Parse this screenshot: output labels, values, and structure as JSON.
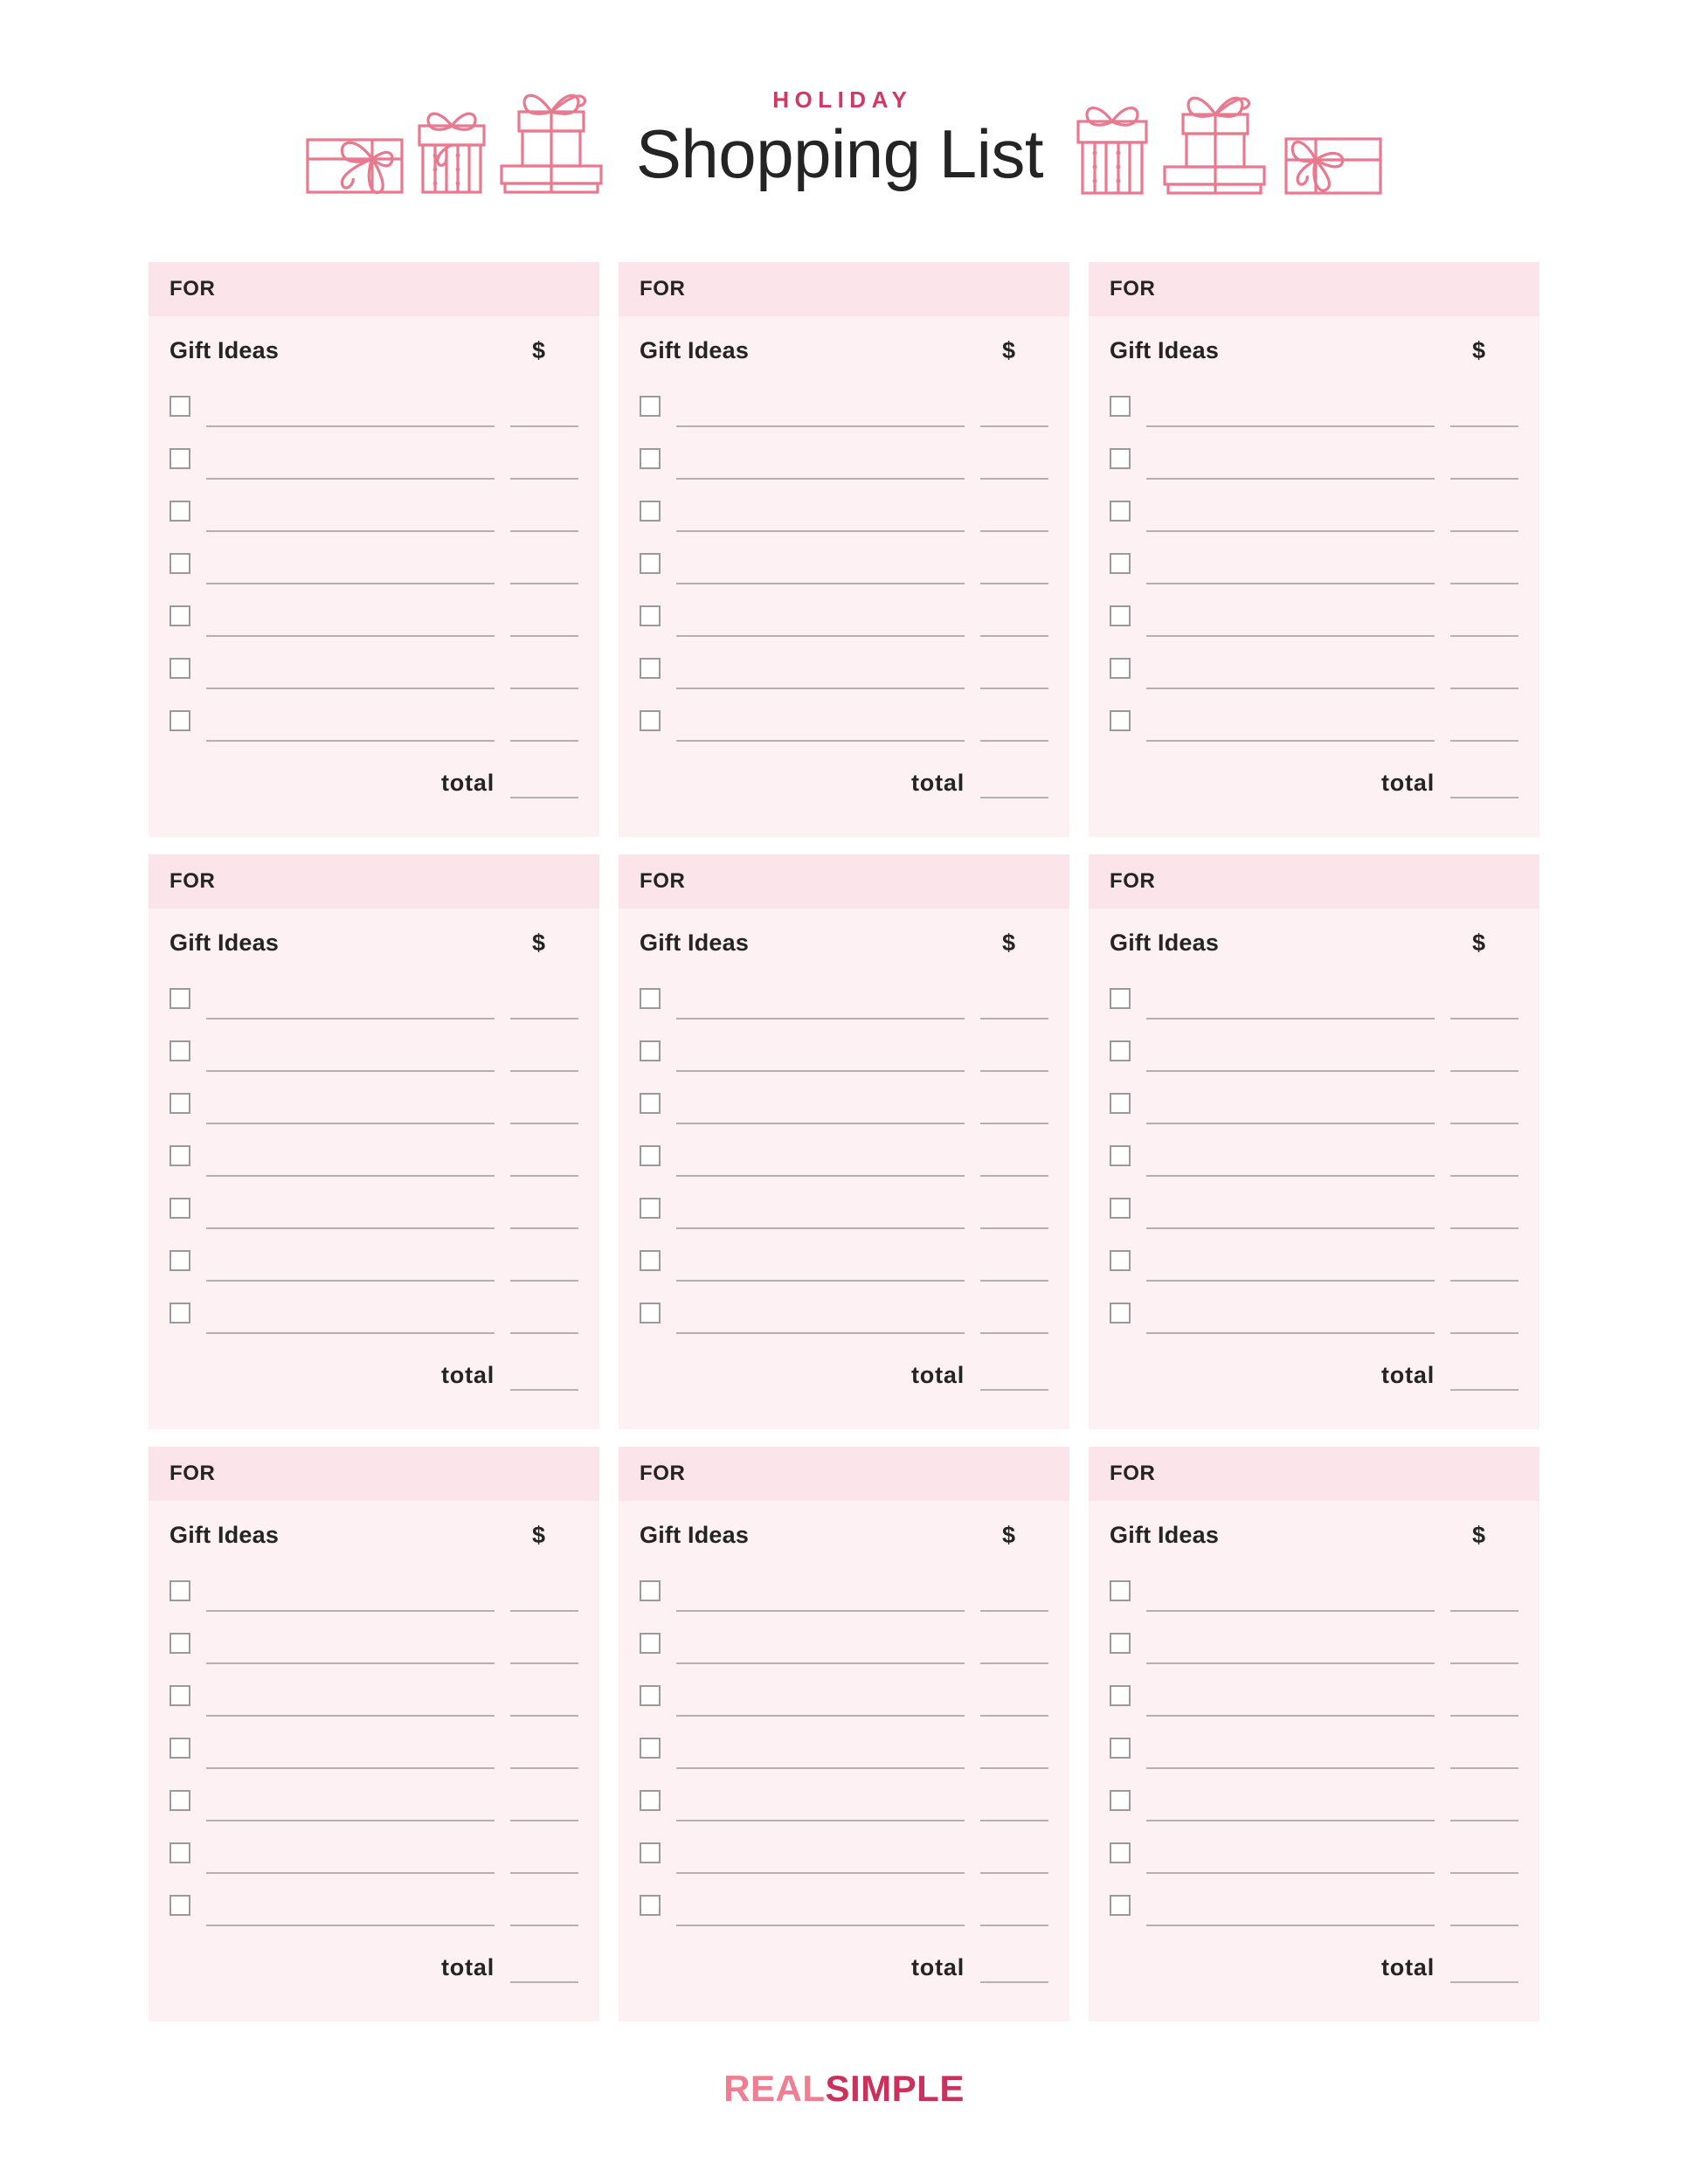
{
  "header": {
    "kicker": "HOLIDAY",
    "title": "Shopping List",
    "left_gifts": [
      "gift-box-wide-bow",
      "gift-box-striped-tall",
      "gift-box-stacked-pair"
    ],
    "right_gifts": [
      "gift-box-striped-tall",
      "gift-box-stacked-pair",
      "gift-box-wide-bow"
    ]
  },
  "labels": {
    "for": "FOR",
    "gift_ideas": "Gift Ideas",
    "dollar": "$",
    "total": "total"
  },
  "grid": {
    "columns": 3,
    "rows": 3,
    "items_per_card": 7
  },
  "cards": [
    {
      "for": "",
      "total": ""
    },
    {
      "for": "",
      "total": ""
    },
    {
      "for": "",
      "total": ""
    },
    {
      "for": "",
      "total": ""
    },
    {
      "for": "",
      "total": ""
    },
    {
      "for": "",
      "total": ""
    },
    {
      "for": "",
      "total": ""
    },
    {
      "for": "",
      "total": ""
    },
    {
      "for": "",
      "total": ""
    }
  ],
  "footer": {
    "logo_first": "REAL",
    "logo_second": "SIMPLE"
  },
  "colors": {
    "kicker": "#CE3A63",
    "title": "#242424",
    "card_header_bg": "#FCE4EB",
    "card_body_bg": "#FDF1F4",
    "rule": "#B5B0B2",
    "checkbox_border": "#9A9A9A",
    "gift_outline": "#E8798F",
    "logo_real": "#EE7E91",
    "logo_simple": "#C8325C",
    "page_bg": "#FFFFFF"
  }
}
